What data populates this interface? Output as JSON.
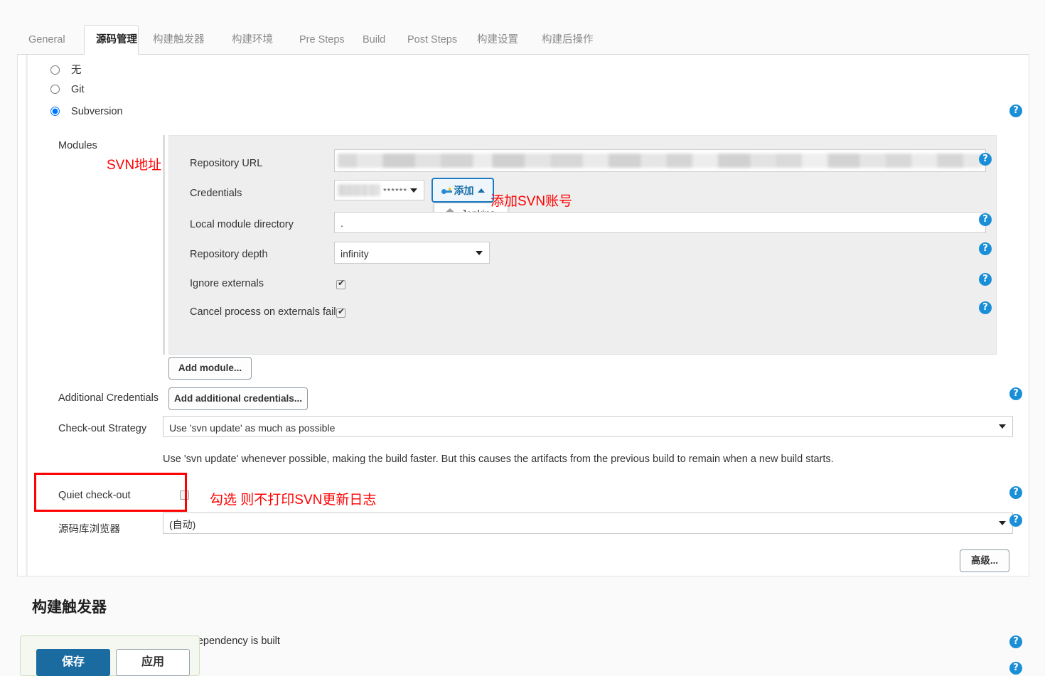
{
  "tabs": [
    {
      "label": "General",
      "active": false
    },
    {
      "label": "源码管理",
      "active": true
    },
    {
      "label": "构建触发器",
      "active": false
    },
    {
      "label": "构建环境",
      "active": false
    },
    {
      "label": "Pre Steps",
      "active": false
    },
    {
      "label": "Build",
      "active": false
    },
    {
      "label": "Post Steps",
      "active": false
    },
    {
      "label": "构建设置",
      "active": false
    },
    {
      "label": "构建后操作",
      "active": false
    }
  ],
  "scm": {
    "options": [
      {
        "label": "无",
        "selected": false
      },
      {
        "label": "Git",
        "selected": false
      },
      {
        "label": "Subversion",
        "selected": true
      }
    ],
    "modules_label": "Modules",
    "fields": {
      "repository_url_label": "Repository URL",
      "repository_url_value": "",
      "credentials_label": "Credentials",
      "credentials_value": "******",
      "local_module_directory_label": "Local module directory",
      "local_module_directory_value": ".",
      "repository_depth_label": "Repository depth",
      "repository_depth_value": "infinity",
      "ignore_externals_label": "Ignore externals",
      "ignore_externals_checked": true,
      "cancel_process_label": "Cancel process on externals fail",
      "cancel_process_checked": true
    },
    "add_credentials_button": "添加",
    "add_credentials_menu": [
      {
        "label": "Jenkins",
        "icon": "jenkins-house-icon"
      }
    ],
    "add_module_button": "Add module...",
    "additional_credentials_label": "Additional Credentials",
    "add_additional_credentials_button": "Add additional credentials...",
    "checkout_strategy_label": "Check-out Strategy",
    "checkout_strategy_value": "Use 'svn update' as much as possible",
    "checkout_strategy_note": "Use 'svn update' whenever possible, making the build faster. But this causes the artifacts from the previous build to remain when a new build starts.",
    "quiet_checkout_label": "Quiet check-out",
    "quiet_checkout_checked": false,
    "repo_browser_label": "源码库浏览器",
    "repo_browser_value": "(自动)",
    "advanced_button": "高级..."
  },
  "annotations": [
    {
      "id": "svn-url",
      "text": "SVN地址"
    },
    {
      "id": "add-svn-account",
      "text": "添加SVN账号"
    },
    {
      "id": "quiet-checkout",
      "text": "勾选 则不打印SVN更新日志"
    }
  ],
  "build_triggers": {
    "title": "构建触发器",
    "snapshot_label": "Build whenever a SNAPSHOT dependency is built"
  },
  "footer": {
    "save_label": "保存",
    "apply_label": "应用"
  },
  "icons": {
    "help": "?",
    "key": "key-icon",
    "caret_down": "▾",
    "caret_up": "▴"
  },
  "colors": {
    "accent_blue": "#1a8fd8",
    "save_blue": "#1a6ba0",
    "annotation_red": "#ff0000",
    "panel_grey": "#eeeeee"
  }
}
